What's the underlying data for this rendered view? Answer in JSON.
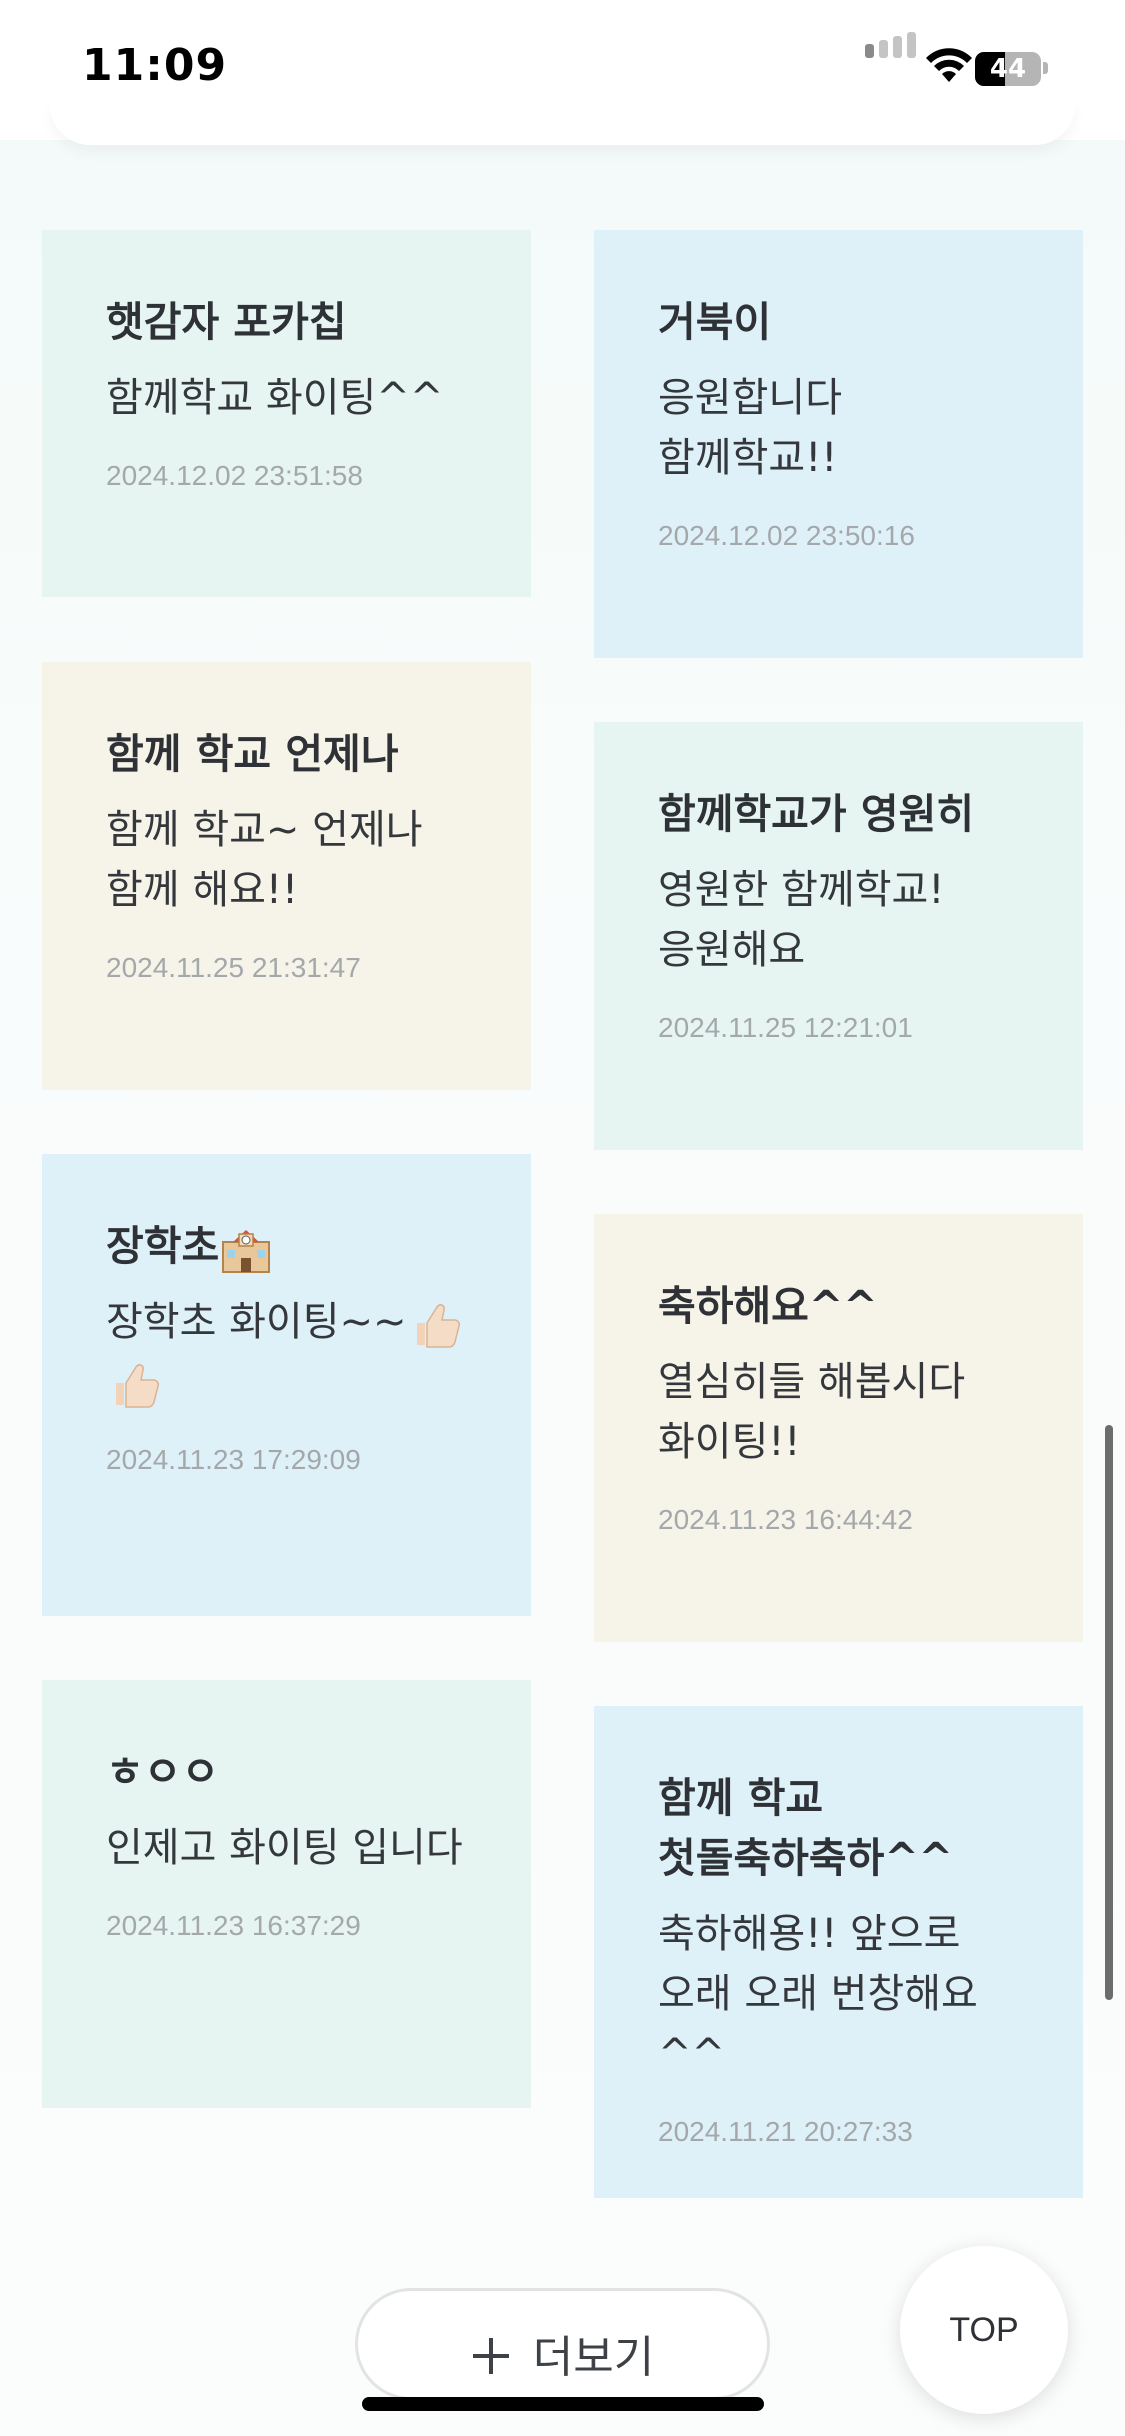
{
  "status_bar": {
    "time": "11:09",
    "battery_level": "44"
  },
  "cards": [
    {
      "title": "햇감자 포카칩",
      "message": "함께학교 화이팅^^",
      "date": "2024.12.02 23:51:58",
      "color": "mint"
    },
    {
      "title": "거북이",
      "message": "응원합니다 함께학교!!",
      "date": "2024.12.02 23:50:16",
      "color": "blue"
    },
    {
      "title": "함께 학교 언제나",
      "message": "함께 학교~ 언제나 함께 해요!!",
      "date": "2024.11.25 21:31:47",
      "color": "cream"
    },
    {
      "title": "함께학교가 영원히",
      "message": "영원한 함께학교! 응원해요",
      "date": "2024.11.25 12:21:01",
      "color": "mint"
    },
    {
      "title": "장학초",
      "title_icon": "school-emoji",
      "message": "장학초 화이팅~~",
      "message_icons": [
        "thumbs-up-emoji",
        "thumbs-up-emoji"
      ],
      "date": "2024.11.23 17:29:09",
      "color": "blue"
    },
    {
      "title": "축하해요^^",
      "message": "열심히들 해봅시다 화이팅!!",
      "date": "2024.11.23 16:44:42",
      "color": "cream"
    },
    {
      "title": "ㅎㅇㅇ",
      "message": "인제고 화이팅 입니다",
      "date": "2024.11.23 16:37:29",
      "color": "mint"
    },
    {
      "title": "함께 학교 첫돌축하축하^^",
      "message": "축하해용!! 앞으로 오래 오래 번창해요^^",
      "date": "2024.11.21 20:27:33",
      "color": "blue"
    }
  ],
  "more_button": {
    "label": "더보기",
    "icon": "plus-icon"
  },
  "top_button": {
    "label": "TOP"
  },
  "colors": {
    "mint": "#e6f5f1",
    "blue": "#dff1f8",
    "cream": "#f6f4e9"
  }
}
